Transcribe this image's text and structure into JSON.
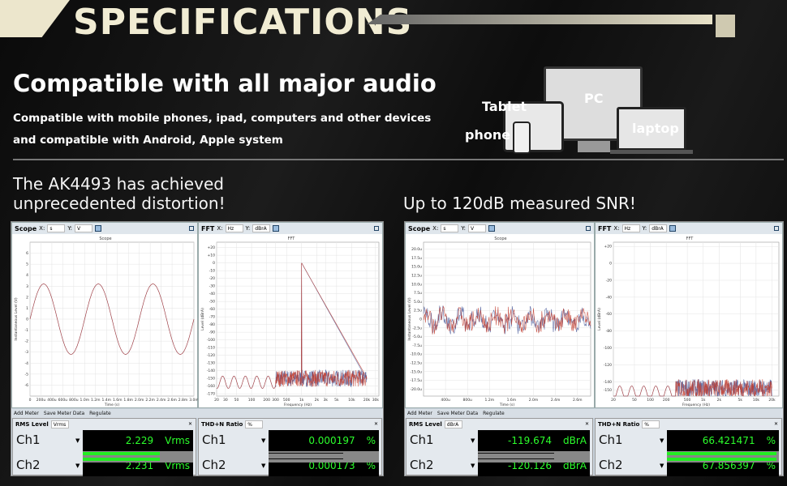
{
  "header": {
    "title": "SPECIFICATIONS",
    "headline": "Compatible with all major audio",
    "subtitle_1": "Compatible with mobile phones, ipad, computers and other devices",
    "subtitle_2": "and compatible with Android, Apple system"
  },
  "devices": {
    "pc": "PC",
    "tablet": "Tablet",
    "phone": "phone",
    "laptop": "laptop"
  },
  "captions": {
    "left_1": "The AK4493 has achieved",
    "left_2": "unprecedented distortion!",
    "right": "Up to 120dB measured SNR!"
  },
  "colors": {
    "accent": "#ece6cc",
    "meter_text": "#2cff2c",
    "ch1_trace": "#c0392b",
    "ch2_trace": "#4a5a9a"
  },
  "screenshots": [
    {
      "scope": {
        "label": "Scope",
        "x_label": "X:",
        "x_unit": "s",
        "y_label": "Y:",
        "y_unit": "V",
        "plot_title": "Scope",
        "xlabel": "Time (s)",
        "ylabel": "Instantaneous Level (V)",
        "yticks": [
          "6",
          "5",
          "4",
          "3",
          "2",
          "1",
          "0",
          "-1",
          "-2",
          "-3",
          "-4",
          "-5",
          "-6"
        ],
        "ymin": -7,
        "ymax": 7,
        "ytick_values": [
          6,
          5,
          4,
          3,
          2,
          1,
          0,
          -1,
          -2,
          -3,
          -4,
          -5,
          -6
        ],
        "xticks": [
          "0",
          "200u",
          "400u",
          "600u",
          "800u",
          "1.0m",
          "1.2m",
          "1.4m",
          "1.6m",
          "1.8m",
          "2.0m",
          "2.2m",
          "2.4m",
          "2.6m",
          "2.8m",
          "3.0m"
        ],
        "signal": "sine",
        "amplitude": 3.2
      },
      "fft": {
        "label": "FFT",
        "x_label": "X:",
        "x_unit": "Hz",
        "y_label": "Y:",
        "y_unit": "dBrA",
        "plot_title": "FFT",
        "xlabel": "Frequency (Hz)",
        "ylabel": "Level (dBrA)",
        "yticks": [
          "+20",
          "+10",
          "0",
          "-10",
          "-20",
          "-30",
          "-40",
          "-50",
          "-60",
          "-70",
          "-80",
          "-90",
          "-100",
          "-110",
          "-120",
          "-130",
          "-140",
          "-150",
          "-160",
          "-170"
        ],
        "ytick_values": [
          20,
          10,
          0,
          -10,
          -20,
          -30,
          -40,
          -50,
          -60,
          -70,
          -80,
          -90,
          -100,
          -110,
          -120,
          -130,
          -140,
          -150,
          -160,
          -170
        ],
        "ymin": -173,
        "ymax": 27,
        "xticks": [
          "20",
          "30",
          "50",
          "100",
          "200",
          "300",
          "500",
          "1k",
          "2k",
          "3k",
          "5k",
          "10k",
          "20k",
          "30k"
        ],
        "xtick_values": [
          20,
          30,
          50,
          100,
          200,
          300,
          500,
          1000,
          2000,
          3000,
          5000,
          10000,
          20000,
          30000
        ],
        "xmin": 20,
        "xmax": 35000,
        "peak_hz": 1000,
        "peak_db": 0,
        "noise_db": -150
      },
      "toolbar": {
        "add": "Add Meter",
        "save": "Save Meter Data",
        "regulate": "Regulate"
      },
      "rms": {
        "label": "RMS Level",
        "unit_select": "Vrms",
        "ch1": "Ch1",
        "ch2": "Ch2",
        "ch1_value": "2.229",
        "ch2_value": "2.231",
        "unit": "Vrms",
        "bar_fill": 0.7
      },
      "thd": {
        "label": "THD+N Ratio",
        "unit_select": "%",
        "ch1": "Ch1",
        "ch2": "Ch2",
        "ch1_value": "0.000197",
        "ch2_value": "0.000173",
        "unit": "%",
        "bar_fill": 0.0
      }
    },
    {
      "scope": {
        "label": "Scope",
        "x_label": "X:",
        "x_unit": "s",
        "y_label": "Y:",
        "y_unit": "V",
        "plot_title": "Scope",
        "xlabel": "Time (s)",
        "ylabel": "Instantaneous Level (V)",
        "yticks": [
          "20.0u",
          "17.5u",
          "15.0u",
          "12.5u",
          "10.0u",
          "7.5u",
          "5.0u",
          "2.5u",
          "0",
          "-2.5u",
          "-5.0u",
          "-7.5u",
          "-10.0u",
          "-12.5u",
          "-15.0u",
          "-17.5u",
          "-20.0u"
        ],
        "ymin": -22,
        "ymax": 22,
        "ytick_values": [
          20,
          17.5,
          15,
          12.5,
          10,
          7.5,
          5,
          2.5,
          0,
          -2.5,
          -5,
          -7.5,
          -10,
          -12.5,
          -15,
          -17.5,
          -20
        ],
        "xticks": [
          "400u",
          "800u",
          "1.2m",
          "1.6m",
          "2.0m",
          "2.4m",
          "2.6m"
        ],
        "signal": "noise",
        "amplitude": 3
      },
      "fft": {
        "label": "FFT",
        "x_label": "X:",
        "x_unit": "Hz",
        "y_label": "Y:",
        "y_unit": "dBrA",
        "plot_title": "FFT",
        "xlabel": "Frequency (Hz)",
        "ylabel": "Level (dBrA)",
        "yticks": [
          "+20",
          "0",
          "-20",
          "-40",
          "-60",
          "-80",
          "-100",
          "-120",
          "-140",
          "-150"
        ],
        "ytick_values": [
          20,
          0,
          -20,
          -40,
          -60,
          -80,
          -100,
          -120,
          -140,
          -150
        ],
        "ymin": -157,
        "ymax": 25,
        "xticks": [
          "20",
          "50",
          "100",
          "200",
          "500",
          "1k",
          "2k",
          "5k",
          "10k",
          "20k"
        ],
        "xtick_values": [
          20,
          50,
          100,
          200,
          500,
          1000,
          2000,
          5000,
          10000,
          20000
        ],
        "xmin": 20,
        "xmax": 27000,
        "peak_hz": null,
        "noise_db": -148
      },
      "toolbar": {
        "add": "Add Meter",
        "save": "Save Meter Data",
        "regulate": "Regulate"
      },
      "rms": {
        "label": "RMS Level",
        "unit_select": "dBrA",
        "ch1": "Ch1",
        "ch2": "Ch2",
        "ch1_value": "-119.674",
        "ch2_value": "-120.126",
        "unit": "dBrA",
        "bar_fill": 0.0
      },
      "thd": {
        "label": "THD+N Ratio",
        "unit_select": "%",
        "ch1": "Ch1",
        "ch2": "Ch2",
        "ch1_value": "66.421471",
        "ch2_value": "67.856397",
        "unit": "%",
        "bar_fill": 0.98
      }
    }
  ]
}
